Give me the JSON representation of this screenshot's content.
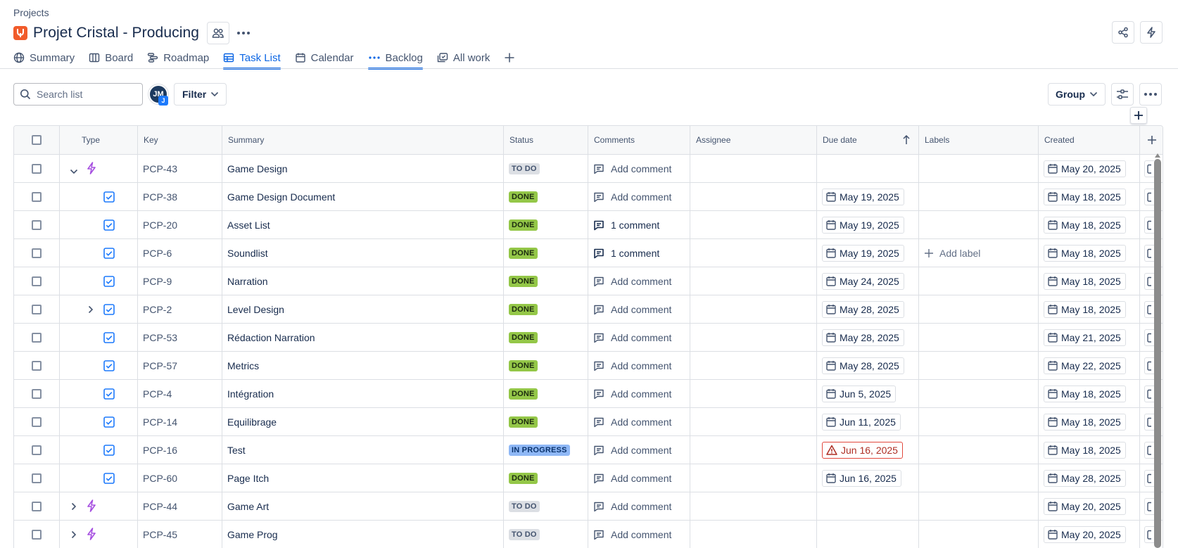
{
  "breadcrumb": "Projects",
  "project": {
    "title": "Projet Cristal - Producing"
  },
  "tabs": [
    {
      "label": "Summary",
      "icon": "globe-icon"
    },
    {
      "label": "Board",
      "icon": "board-icon"
    },
    {
      "label": "Roadmap",
      "icon": "roadmap-icon"
    },
    {
      "label": "Task List",
      "icon": "table-icon",
      "active": true
    },
    {
      "label": "Calendar",
      "icon": "calendar-icon"
    },
    {
      "label": "Backlog",
      "icon": "dots-icon"
    },
    {
      "label": "All work",
      "icon": "stack-icon"
    }
  ],
  "toolbar": {
    "search_placeholder": "Search list",
    "avatar_initials": "JM",
    "avatar_badge": "J",
    "filter_label": "Filter",
    "group_label": "Group"
  },
  "columns": [
    "Type",
    "Key",
    "Summary",
    "Status",
    "Comments",
    "Assignee",
    "Due date",
    "Labels",
    "Created"
  ],
  "rows": [
    {
      "type": "epic",
      "expand": "open",
      "key": "PCP-43",
      "summary": "Game Design",
      "status": "TO DO",
      "status_kind": "todo",
      "comment": "Add comment",
      "comment_has": false,
      "due": "",
      "label": "",
      "created": "May 20, 2025"
    },
    {
      "type": "task",
      "expand": "",
      "key": "PCP-38",
      "summary": "Game Design Document",
      "status": "DONE",
      "status_kind": "done",
      "comment": "Add comment",
      "comment_has": false,
      "due": "May 19, 2025",
      "label": "",
      "created": "May 18, 2025"
    },
    {
      "type": "task",
      "expand": "",
      "key": "PCP-20",
      "summary": "Asset List",
      "status": "DONE",
      "status_kind": "done",
      "comment": "1 comment",
      "comment_has": true,
      "due": "May 19, 2025",
      "label": "",
      "created": "May 18, 2025"
    },
    {
      "type": "task",
      "expand": "",
      "key": "PCP-6",
      "summary": "Soundlist",
      "status": "DONE",
      "status_kind": "done",
      "comment": "1 comment",
      "comment_has": true,
      "due": "May 19, 2025",
      "label": "Add label",
      "created": "May 18, 2025"
    },
    {
      "type": "task",
      "expand": "",
      "key": "PCP-9",
      "summary": "Narration",
      "status": "DONE",
      "status_kind": "done",
      "comment": "Add comment",
      "comment_has": false,
      "due": "May 24, 2025",
      "label": "",
      "created": "May 18, 2025"
    },
    {
      "type": "task",
      "expand": "closed",
      "key": "PCP-2",
      "summary": "Level Design",
      "status": "DONE",
      "status_kind": "done",
      "comment": "Add comment",
      "comment_has": false,
      "due": "May 28, 2025",
      "label": "",
      "created": "May 18, 2025"
    },
    {
      "type": "task",
      "expand": "",
      "key": "PCP-53",
      "summary": "Rédaction Narration",
      "status": "DONE",
      "status_kind": "done",
      "comment": "Add comment",
      "comment_has": false,
      "due": "May 28, 2025",
      "label": "",
      "created": "May 21, 2025"
    },
    {
      "type": "task",
      "expand": "",
      "key": "PCP-57",
      "summary": "Metrics",
      "status": "DONE",
      "status_kind": "done",
      "comment": "Add comment",
      "comment_has": false,
      "due": "May 28, 2025",
      "label": "",
      "created": "May 22, 2025"
    },
    {
      "type": "task",
      "expand": "",
      "key": "PCP-4",
      "summary": "Intégration",
      "status": "DONE",
      "status_kind": "done",
      "comment": "Add comment",
      "comment_has": false,
      "due": "Jun 5, 2025",
      "label": "",
      "created": "May 18, 2025"
    },
    {
      "type": "task",
      "expand": "",
      "key": "PCP-14",
      "summary": "Equilibrage",
      "status": "DONE",
      "status_kind": "done",
      "comment": "Add comment",
      "comment_has": false,
      "due": "Jun 11, 2025",
      "label": "",
      "created": "May 18, 2025"
    },
    {
      "type": "task",
      "expand": "",
      "key": "PCP-16",
      "summary": "Test",
      "status": "IN PROGRESS",
      "status_kind": "progress",
      "comment": "Add comment",
      "comment_has": false,
      "due": "Jun 16, 2025",
      "due_overdue": true,
      "label": "",
      "created": "May 18, 2025"
    },
    {
      "type": "task",
      "expand": "",
      "key": "PCP-60",
      "summary": "Page Itch",
      "status": "DONE",
      "status_kind": "done",
      "comment": "Add comment",
      "comment_has": false,
      "due": "Jun 16, 2025",
      "label": "",
      "created": "May 28, 2025"
    },
    {
      "type": "epic",
      "expand": "closed",
      "key": "PCP-44",
      "summary": "Game Art",
      "status": "TO DO",
      "status_kind": "todo",
      "comment": "Add comment",
      "comment_has": false,
      "due": "",
      "label": "",
      "created": "May 20, 2025"
    },
    {
      "type": "epic",
      "expand": "closed",
      "key": "PCP-45",
      "summary": "Game Prog",
      "status": "TO DO",
      "status_kind": "todo",
      "comment": "Add comment",
      "comment_has": false,
      "due": "",
      "label": "",
      "created": "May 20, 2025"
    }
  ],
  "colors": {
    "accent": "#0c66e4",
    "done": "#94c748",
    "todo": "#dcdfe4",
    "progress": "#8fb8f6",
    "overdue": "#ae2e24",
    "epic": "#a54ee0",
    "task": "#1d7afc",
    "brand": "#f15b2a"
  }
}
